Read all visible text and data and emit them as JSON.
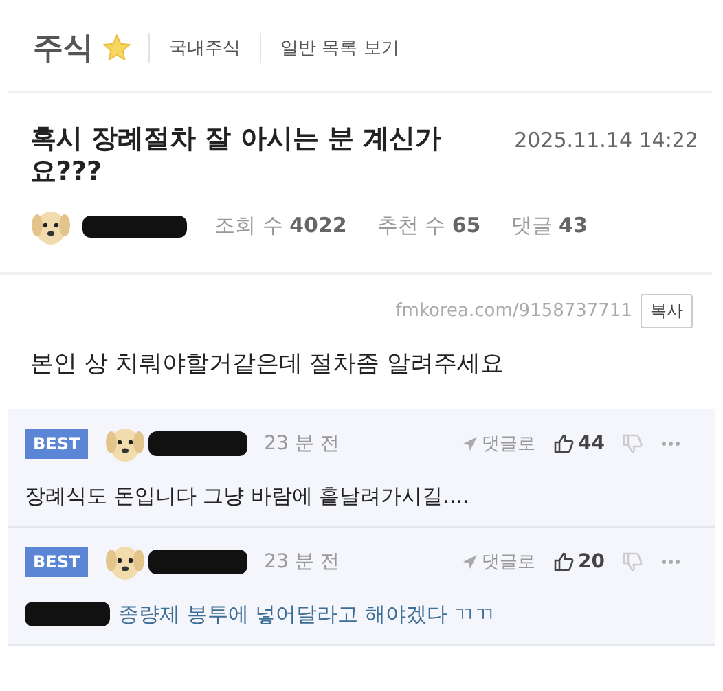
{
  "board": {
    "title": "주식",
    "links": [
      "국내주식",
      "일반 목록 보기"
    ]
  },
  "post": {
    "title": "혹시 장례절차 잘 아시는 분 계신가요???",
    "date": "2025.11.14 14:22",
    "stats": [
      {
        "label": "조회 수",
        "value": "4022"
      },
      {
        "label": "추천 수",
        "value": "65"
      },
      {
        "label": "댓글",
        "value": "43"
      }
    ],
    "url": "fmkorea.com/9158737711",
    "copy": "복사",
    "body": "본인 상 치뤄야할거같은데 절차좀 알려주세요"
  },
  "comments": [
    {
      "kind": "plain",
      "badge": "BEST",
      "time": "23 분 전",
      "reply": "댓글로",
      "likes": "44",
      "text": "장례식도 돈입니다 그냥 바람에 흩날려가시길...."
    },
    {
      "kind": "mention",
      "badge": "BEST",
      "time": "23 분 전",
      "reply": "댓글로",
      "likes": "20",
      "text": "종량제 봉투에 넣어달라고 해야겠다 ㄲㄲ"
    }
  ]
}
